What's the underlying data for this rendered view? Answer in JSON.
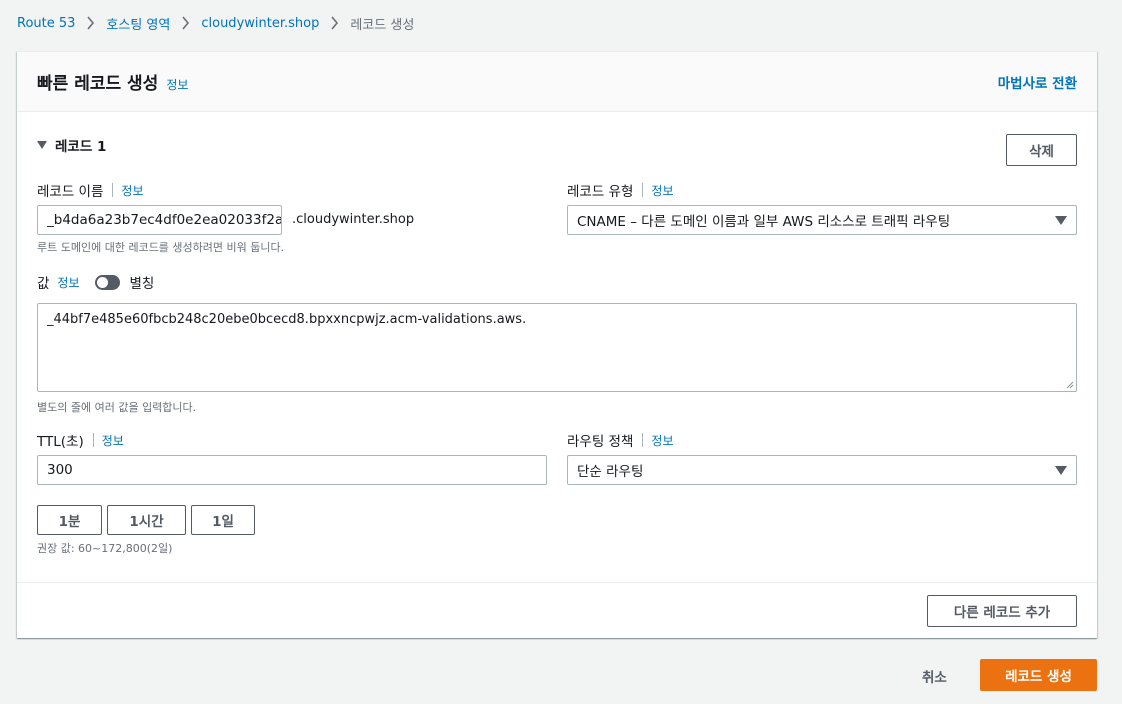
{
  "breadcrumb": {
    "items": [
      "Route 53",
      "호스팅 영역",
      "cloudywinter.shop"
    ],
    "current": "레코드 생성"
  },
  "panel": {
    "title": "빠른 레코드 생성",
    "info": "정보",
    "wizard_link": "마법사로 전환"
  },
  "record": {
    "section_title": "레코드 1",
    "delete_label": "삭제",
    "name": {
      "label": "레코드 이름",
      "info": "정보",
      "value": "_b4da6a23b7ec4df0e2ea02033f2a",
      "suffix": ".cloudywinter.shop",
      "hint": "루트 도메인에 대한 레코드를 생성하려면 비워 둡니다."
    },
    "type": {
      "label": "레코드 유형",
      "info": "정보",
      "value": "CNAME – 다른 도메인 이름과 일부 AWS 리소스로 트래픽 라우팅"
    },
    "value": {
      "label": "값",
      "info": "정보",
      "alias_label": "별칭",
      "text": "_44bf7e485e60fbcb248c20ebe0bcecd8.bpxxncpwjz.acm-validations.aws.",
      "hint": "별도의 줄에 여러 값을 입력합니다."
    },
    "ttl": {
      "label": "TTL(초)",
      "info": "정보",
      "value": "300",
      "presets": [
        "1분",
        "1시간",
        "1일"
      ],
      "hint": "권장 값: 60~172,800(2일)"
    },
    "routing": {
      "label": "라우팅 정책",
      "info": "정보",
      "value": "단순 라우팅"
    }
  },
  "add_record_label": "다른 레코드 추가",
  "footer": {
    "cancel_label": "취소",
    "create_label": "레코드 생성"
  },
  "colors": {
    "link": "#0073bb",
    "primary": "#ec7211",
    "background": "#f2f3f3"
  }
}
